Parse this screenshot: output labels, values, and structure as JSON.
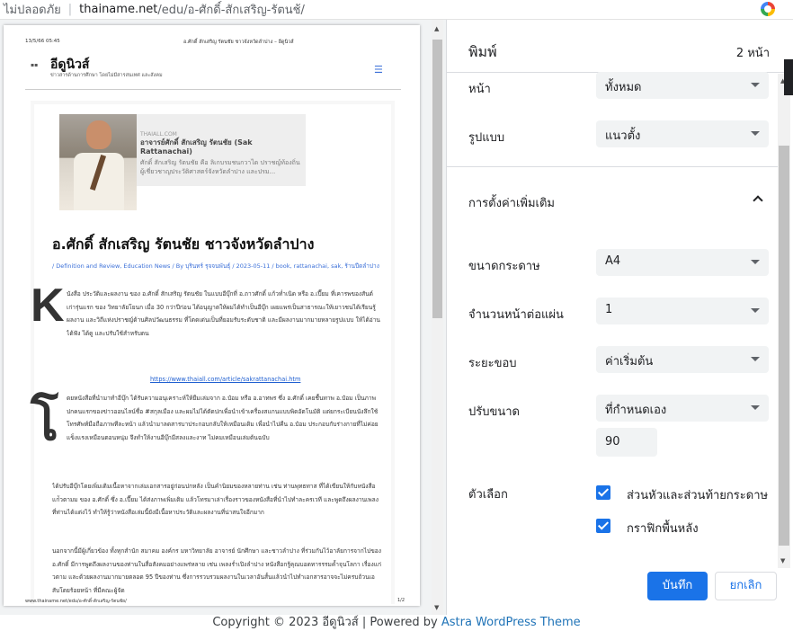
{
  "browser": {
    "security_label": "ไม่ปลอดภัย",
    "url_domain": "thainame.net",
    "url_path": "/edu/อ-ศักดิ์-สักเสริญ-รัตนช้/"
  },
  "preview": {
    "header_date": "13/5/66 05:45",
    "header_title": "อ.ศักดิ์ สักเสริญ รัตนชัย ชาวจังหวัดลำปาง – อีดูนิวส์",
    "site_name": "อีดูนิวส์",
    "site_tagline": "ข่าวสารด้านการศึกษา โดยไม่มีสารสนเทศ และสังคม",
    "embed": {
      "site": "THAIALL.COM",
      "title": "อาจารย์ศักดิ์ สักเสริญ รัตนชัย (Sak Rattanachai)",
      "desc": "ศักดิ์ สักเสริญ รัตนชัย คือ ลิเกบรมชนกวาได ปราชญ์ท้องถิ่นผู้เชี่ยวชาญประวัติศาสตร์จังหวัดลำปาง และปรม..."
    },
    "article_title": "อ.ศักดิ์ สักเสริญ รัตนชัย ชาวจังหวัดลำปาง",
    "article_meta": "/ Definition and Review, Education News / By บุรินทร์ รุจจนพันธุ์ / 2023-05-11 / book, rattanachai, sak, ร้านปีดลำปาง",
    "dropcap_1": "K",
    "para_1": "นังสือ ประวัติและผลงาน ของ อ.ศักดิ์ สักเสริญ รัตนชัย ในแบบอีบุ๊กที่ อ.ถาวศักดิ์ แก้วท่ำเนิด หรือ อ.เปี๊ยม ที่เคารพของสันต์เก่ารุ่นแรก ของ วิทยาลัยโยนก เมื่อ 30 กว่าปีก่อน ได้อนุญาตให้ผมได้ทำเป็นอีบุ๊ก เผยแพร่เป็นสาธารณะให้เยาวชนได้เรียนรู้ผลงาน และวิถีแห่งปราชญ์ด้านศิลปวัฒนธรรม ที่โดดเด่นเป็นที่ยอมรับระดับชาติ และมีผลงานมากมายหลายรูปแบบ ให้ได้อ่าน ได้ฟัง ได้ดู และปรับใช้สำหรับตน",
    "link": "https://www.thaiall.com/article/sakrattanachai.htm",
    "dropcap_2": "โ",
    "para_2": "ดยหนังสือที่นำมาทำอีบุ๊ก ได้รับความอนุเคราะห์ให้ยืมเล่มจาก อ.ป๋อม หรือ อ.อาทพร ซึ่ง อ.ศักดิ์ เคยชื้นทาพ อ.ป๋อม เป็นภาพปกคนแรกของข่าวออนไลน์ชื่อ #สกุลเมือง และผมไม่ได้ตัดปกเพื่อนำเข้าเครื่องสแกนแบบพิดอัตโนมัติ แต่ยกระเบียนนังลึกใช้โทรศัพท์มือถือภาพทีละหน้า แล้วนำมาลดสารบาประกอบกลับให้เหมือนเดิม เพื่อนำไปคืน อ.ป๋อม ประกอบกับร่างกายที่ไม่ค่อยแข็งแรงเหมือนตอนหนุ่ม จึงทำให้งานอีบุ๊กมีสลงและงาท ไม่คมเหมือนเล่มต้นฉบับ",
    "para_3": "ได้ปรับอีบุ๊กโดยเพิ่มเติมเนื้อหาจากเล่มเอกสารอยู่ก่อนปกหลัง เป็นคำนิยมของหลายท่าน เช่น ท่านพุทธทาส ที่ได้เขียนให้กับหนังสือแก่ัวตามม ของ อ.ศักดิ์ ซึ่ง อ.เปี๊ยม ได้ส่งภาพเพิ่มเติม แล้วโทรมาเล่าเรื่องราวของหนังสือที่นำไปทำละครเวที และพูดถึงผลงานเพลงที่ท่านได้แต่งไว้ ทำให้รู้ว่าหนังสือเล่มนี้ยังมีเนื้อหาประวัติและผลงานที่น่าสนใจอีกมาก",
    "para_4": "นอกจากนี้มีผู้เกี่ยวข้อง ทั้งทุกสำนัก สมาคม องค์กร มหาวิทยาลัย อาจารย์ นักศึกษา และชาวลำปาง ที่ร่วมกันไว้อาลัยการจากไปของ อ.ศักดิ์ มีการพูดถึงผลงานของท่านในสื่อสังคมอย่างแพร่หลาย เช่น เพลงร่ำเปิงลำปาง หนังสือกรู้คุณบอดทารรรมค้ำจุนโลกา เรื่องแก่วตาม และด้วยผลงานมากมายตลอด 95 ปีของท่าน ซึ่งการรวบรวมผลงานในเวลาอันสั้นแล้วนำไปทำเอกสารอาจจะไม่ครบถ้วนเอสับโดยร้อยหน้า ที่มีคณะผู้จัด",
    "footer_left": "www.thainame.net/edu/อ-ศักดิ์-สักเสริญ-รัตนชัย/",
    "footer_right": "1/2"
  },
  "dialog": {
    "title": "พิมพ์",
    "page_count": "2 หน้า",
    "pages_label": "หน้า",
    "pages_value": "ทั้งหมด",
    "layout_label": "รูปแบบ",
    "layout_value": "แนวตั้ง",
    "more_settings_label": "การตั้งค่าเพิ่มเติม",
    "paper_size_label": "ขนาดกระดาษ",
    "paper_size_value": "A4",
    "pages_per_sheet_label": "จำนวนหน้าต่อแผ่น",
    "pages_per_sheet_value": "1",
    "margins_label": "ระยะขอบ",
    "margins_value": "ค่าเริ่มต้น",
    "scale_label": "ปรับขนาด",
    "scale_value": "ที่กำหนดเอง",
    "scale_number": "90",
    "options_label": "ตัวเลือก",
    "option_headers": "ส่วนหัวและส่วนท้ายกระดาษ",
    "option_headers_checked": true,
    "option_background": "กราฟิกพื้นหลัง",
    "option_background_checked": true,
    "save_label": "บันทึก",
    "cancel_label": "ยกเลิก"
  },
  "page_footer": {
    "copyright": "Copyright © 2023 อีดูนิวส์ | Powered by ",
    "theme_link": "Astra WordPress Theme"
  },
  "colors": {
    "accent": "#1a73e8",
    "link": "#3a6fd8"
  }
}
